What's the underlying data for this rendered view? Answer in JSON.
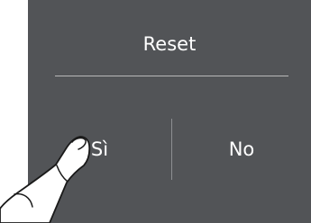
{
  "dialog": {
    "title": "Reset",
    "yes_label": "Sì",
    "no_label": "No"
  },
  "colors": {
    "panel": "#525457",
    "text": "#ffffff",
    "divider": "#b9b9b9"
  },
  "illustration": {
    "icon": "pointing-finger-icon"
  }
}
